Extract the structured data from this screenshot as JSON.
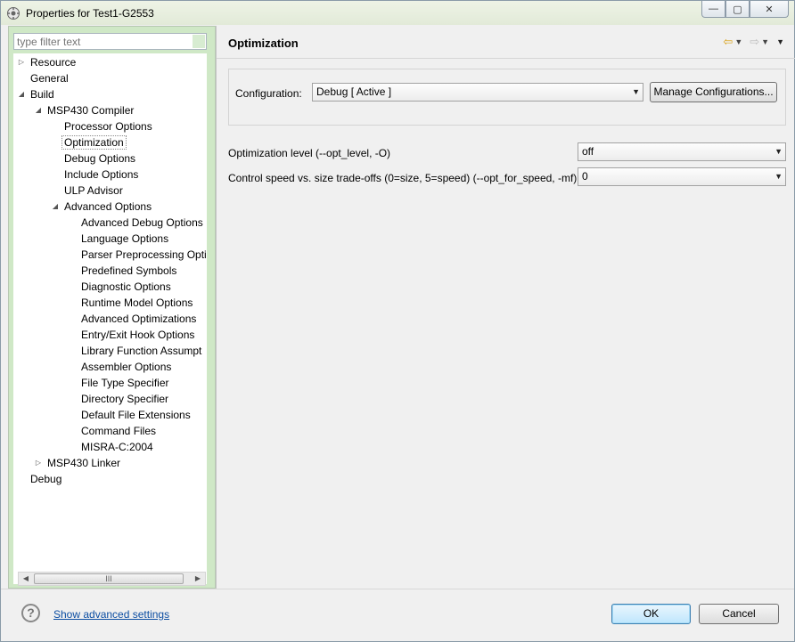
{
  "window": {
    "title": "Properties for Test1-G2553",
    "controls": {
      "minimize": "—",
      "maximize": "▢",
      "close": "✕"
    }
  },
  "filter": {
    "placeholder": "type filter text"
  },
  "tree": [
    {
      "label": "Resource",
      "depth": 0,
      "twisty": "collapsed"
    },
    {
      "label": "General",
      "depth": 0,
      "twisty": "none"
    },
    {
      "label": "Build",
      "depth": 0,
      "twisty": "expanded"
    },
    {
      "label": "MSP430 Compiler",
      "depth": 1,
      "twisty": "expanded"
    },
    {
      "label": "Processor Options",
      "depth": 2,
      "twisty": "none"
    },
    {
      "label": "Optimization",
      "depth": 2,
      "twisty": "none",
      "selected": true
    },
    {
      "label": "Debug Options",
      "depth": 2,
      "twisty": "none"
    },
    {
      "label": "Include Options",
      "depth": 2,
      "twisty": "none"
    },
    {
      "label": "ULP Advisor",
      "depth": 2,
      "twisty": "none"
    },
    {
      "label": "Advanced Options",
      "depth": 2,
      "twisty": "expanded"
    },
    {
      "label": "Advanced Debug Options",
      "depth": 3,
      "twisty": "none"
    },
    {
      "label": "Language Options",
      "depth": 3,
      "twisty": "none"
    },
    {
      "label": "Parser Preprocessing Opti",
      "depth": 3,
      "twisty": "none"
    },
    {
      "label": "Predefined Symbols",
      "depth": 3,
      "twisty": "none"
    },
    {
      "label": "Diagnostic Options",
      "depth": 3,
      "twisty": "none"
    },
    {
      "label": "Runtime Model Options",
      "depth": 3,
      "twisty": "none"
    },
    {
      "label": "Advanced Optimizations",
      "depth": 3,
      "twisty": "none"
    },
    {
      "label": "Entry/Exit Hook Options",
      "depth": 3,
      "twisty": "none"
    },
    {
      "label": "Library Function Assumpt",
      "depth": 3,
      "twisty": "none"
    },
    {
      "label": "Assembler Options",
      "depth": 3,
      "twisty": "none"
    },
    {
      "label": "File Type Specifier",
      "depth": 3,
      "twisty": "none"
    },
    {
      "label": "Directory Specifier",
      "depth": 3,
      "twisty": "none"
    },
    {
      "label": "Default File Extensions",
      "depth": 3,
      "twisty": "none"
    },
    {
      "label": "Command Files",
      "depth": 3,
      "twisty": "none"
    },
    {
      "label": "MISRA-C:2004",
      "depth": 3,
      "twisty": "none"
    },
    {
      "label": "MSP430 Linker",
      "depth": 1,
      "twisty": "collapsed"
    },
    {
      "label": "Debug",
      "depth": 0,
      "twisty": "none"
    }
  ],
  "scrollbar": {
    "thumb_grip": "III"
  },
  "page": {
    "title": "Optimization",
    "configuration_label": "Configuration:",
    "configuration_value": "Debug  [ Active ]",
    "manage_button": "Manage Configurations...",
    "opt_level_label": "Optimization level (--opt_level, -O)",
    "opt_level_value": "off",
    "speed_label": "Control speed vs. size trade-offs (0=size, 5=speed) (--opt_for_speed, -mf)",
    "speed_value": "0"
  },
  "footer": {
    "help_glyph": "?",
    "advanced_link": "Show advanced settings",
    "ok": "OK",
    "cancel": "Cancel"
  },
  "icons": {
    "back": "⇦",
    "forward": "⇨",
    "dropdown": "▼",
    "view_menu": "▼"
  }
}
